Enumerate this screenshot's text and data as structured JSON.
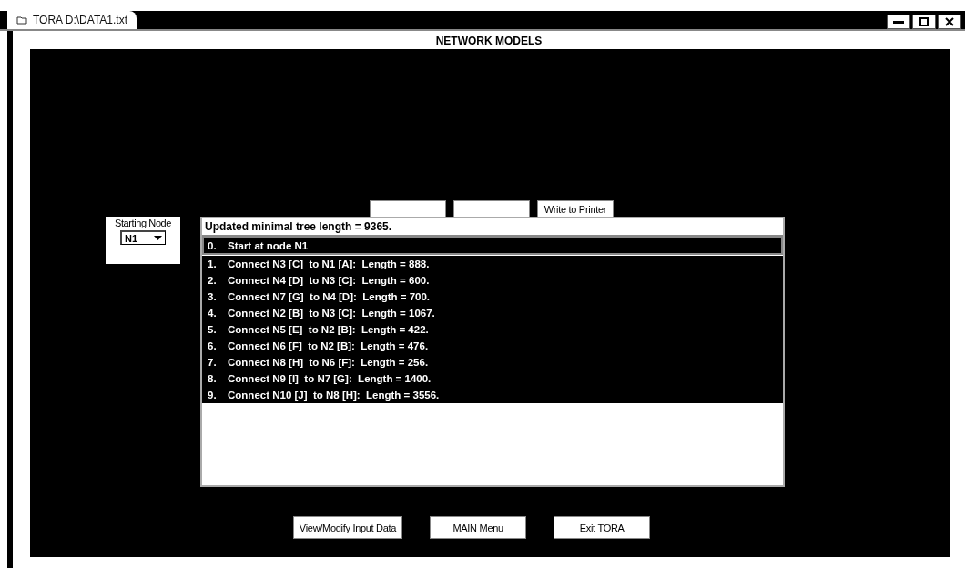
{
  "window": {
    "title": "TORA  D:\\DATA1.txt",
    "heading": "NETWORK MODELS"
  },
  "starting_node": {
    "label": "Starting Node",
    "value": "N1"
  },
  "tabs": [
    {
      "kind": "blank"
    },
    {
      "kind": "blank"
    },
    {
      "label": "Write to Printer",
      "kind": "text"
    }
  ],
  "results": {
    "header": "Updated minimal tree length = 9365.",
    "rows": [
      {
        "number": "0.",
        "text": "Start at node N1",
        "selected": true
      },
      {
        "number": "1.",
        "text": "Connect N3 [C]  to N1 [A]:  Length = 888.",
        "selected": false
      },
      {
        "number": "2.",
        "text": "Connect N4 [D]  to N3 [C]:  Length = 600.",
        "selected": false
      },
      {
        "number": "3.",
        "text": "Connect N7 [G]  to N4 [D]:  Length = 700.",
        "selected": false
      },
      {
        "number": "4.",
        "text": "Connect N2 [B]  to N3 [C]:  Length = 1067.",
        "selected": false
      },
      {
        "number": "5.",
        "text": "Connect N5 [E]  to N2 [B]:  Length = 422.",
        "selected": false
      },
      {
        "number": "6.",
        "text": "Connect N6 [F]  to N2 [B]:  Length = 476.",
        "selected": false
      },
      {
        "number": "7.",
        "text": "Connect N8 [H]  to N6 [F]:  Length = 256.",
        "selected": false
      },
      {
        "number": "8.",
        "text": "Connect N9 [I]  to N7 [G]:  Length = 1400.",
        "selected": false
      },
      {
        "number": "9.",
        "text": "Connect N10 [J]  to N8 [H]:  Length = 3556.",
        "selected": false
      }
    ]
  },
  "buttons": [
    "View/Modify Input Data",
    "MAIN Menu",
    "Exit TORA"
  ]
}
